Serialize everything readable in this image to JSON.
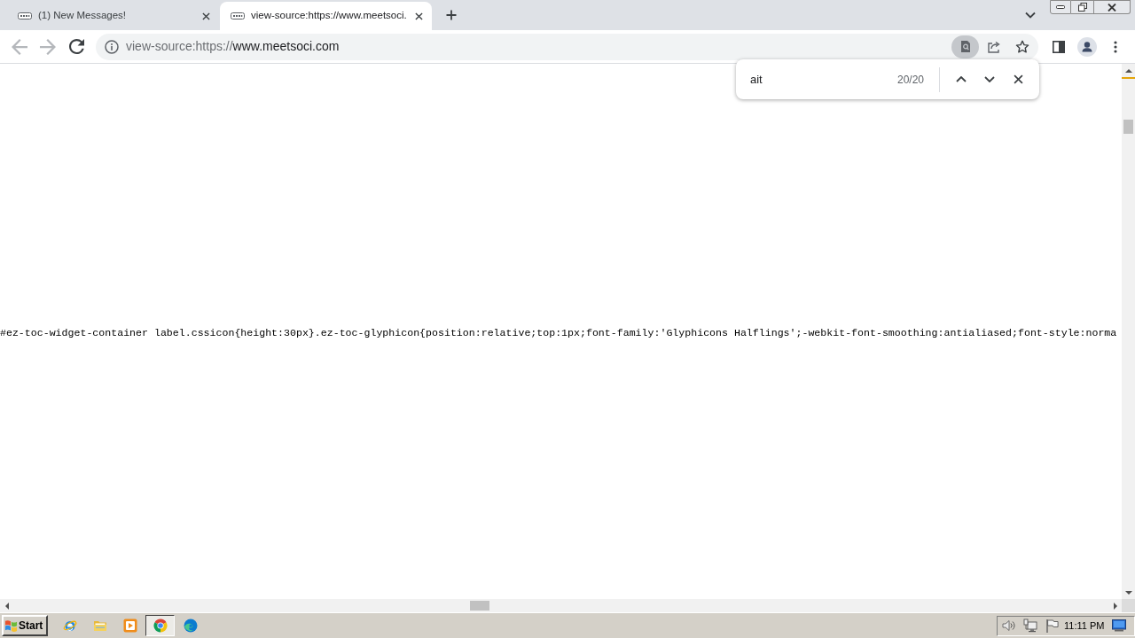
{
  "browser": {
    "tabs": [
      {
        "title": "(1) New Messages!",
        "selected": false
      },
      {
        "title": "view-source:https://www.meetsoci.",
        "selected": true
      }
    ],
    "toolbar": {
      "back": {
        "disabled": true
      },
      "forward": {
        "disabled": true
      },
      "url": [
        {
          "text": "view-source:https://",
          "dim": true
        },
        {
          "text": "www.meetsoci.com",
          "dim": false
        }
      ]
    },
    "find_bar": {
      "query": "ait",
      "count": "20/20"
    }
  },
  "page": {
    "source_line": "#ez-toc-widget-container label.cssicon{height:30px}.ez-toc-glyphicon{position:relative;top:1px;font-family:'Glyphicons Halflings';-webkit-font-smoothing:antialiased;font-style:norma"
  },
  "taskbar": {
    "start": "Start",
    "apps": [
      {
        "kind": "ie",
        "selected": false
      },
      {
        "kind": "folder",
        "selected": false
      },
      {
        "kind": "media",
        "selected": false
      },
      {
        "kind": "chrome",
        "selected": true
      },
      {
        "kind": "edge",
        "selected": false
      }
    ],
    "clock": "11:11 PM"
  }
}
